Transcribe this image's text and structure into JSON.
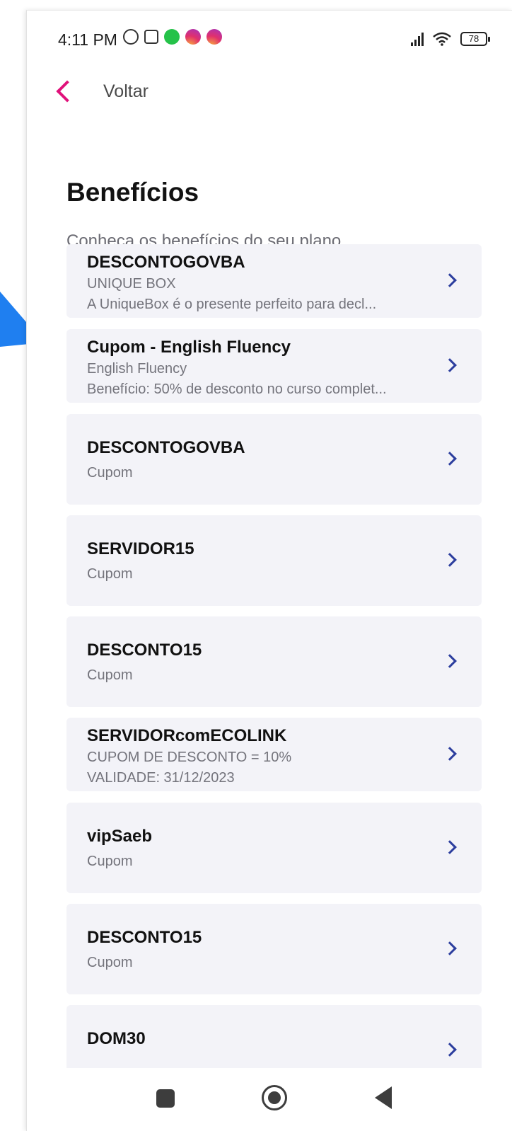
{
  "status": {
    "time": "4:11 PM",
    "battery": "78",
    "icons": [
      "alarm-icon",
      "nfc-icon",
      "whatsapp-icon",
      "instagram-icon",
      "instagram-icon"
    ]
  },
  "header": {
    "back_label": "Voltar"
  },
  "page": {
    "title": "Benefícios",
    "subtitle": "Conheça os benefícios do seu plano"
  },
  "benefits": [
    {
      "title": "DESCONTOGOVBA",
      "line1": "UNIQUE BOX",
      "line2": "A UniqueBox é o presente perfeito para decl..."
    },
    {
      "title": "Cupom - English Fluency",
      "line1": "English Fluency",
      "line2": "Benefício: 50% de desconto no curso complet..."
    },
    {
      "title": "DESCONTOGOVBA",
      "line1": "Cupom"
    },
    {
      "title": "SERVIDOR15",
      "line1": "Cupom"
    },
    {
      "title": "DESCONTO15",
      "line1": "Cupom"
    },
    {
      "title": "SERVIDORcomECOLINK",
      "line1": "CUPOM DE DESCONTO = 10%",
      "line2": "VALIDADE: 31/12/2023"
    },
    {
      "title": "vipSaeb",
      "line1": "Cupom"
    },
    {
      "title": "DESCONTO15",
      "line1": "Cupom"
    },
    {
      "title": "DOM30"
    }
  ],
  "colors": {
    "accent_back": "#e0117a",
    "chevron": "#2c3e9e",
    "card_bg": "#f3f3f8",
    "pointer": "#1f7ff0"
  }
}
